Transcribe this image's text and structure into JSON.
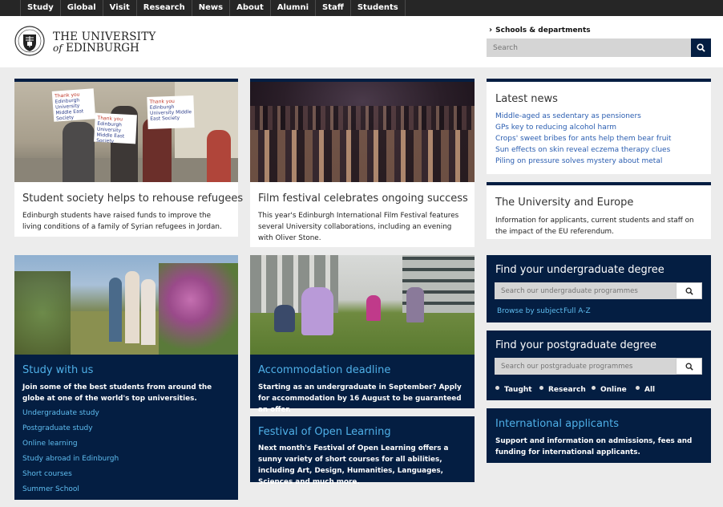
{
  "topnav": [
    "Study",
    "Global",
    "Visit",
    "Research",
    "News",
    "About",
    "Alumni",
    "Staff",
    "Students"
  ],
  "logo": {
    "line1": "THE UNIVERSITY",
    "line2_of": "of",
    "line2": "EDINBURGH"
  },
  "header": {
    "schools_link": "Schools & departments",
    "search_placeholder": "Search"
  },
  "cards": {
    "refugees": {
      "title": "Student society helps to rehouse refugees",
      "text": "Edinburgh students have raised funds to improve the living conditions of a family of Syrian refugees in Jordan.",
      "sign1": "Thank you",
      "sign2": "Edinburgh University Middle East Society"
    },
    "film": {
      "title": "Film festival celebrates ongoing success",
      "text": "This year's Edinburgh International Film Festival features several University collaborations, including an evening with Oliver Stone."
    },
    "study": {
      "title": "Study with us",
      "text": "Join some of the best students from around the globe at one of the world's top universities.",
      "links": [
        "Undergraduate study",
        "Postgraduate study",
        "Online learning",
        "Study abroad in Edinburgh",
        "Short courses",
        "Summer School"
      ]
    },
    "accommodation": {
      "title": "Accommodation deadline",
      "text": "Starting as an undergraduate in September?  Apply for accommodation by 16 August to be guaranteed an offer."
    },
    "open_learning": {
      "title": "Festival of Open Learning",
      "text": "Next month's Festival of Open Learning offers a sunny variety of short courses for all abilities, including Art, Design, Humanities, Languages, Sciences and much more."
    }
  },
  "news": {
    "title": "Latest news",
    "items": [
      "Middle-aged as sedentary as pensioners",
      "GPs key to reducing alcohol harm",
      "Crops' sweet bribes for ants help them bear fruit",
      "Sun effects on skin reveal eczema therapy clues",
      "Piling on pressure solves mystery about metal"
    ]
  },
  "europe": {
    "title": "The University and Europe",
    "text": "Information for applicants, current students and staff on the impact of the EU referendum."
  },
  "undergrad": {
    "title": "Find your undergraduate degree",
    "placeholder": "Search our undergraduate programmes",
    "links": [
      "Browse by subject",
      "Full A-Z"
    ]
  },
  "postgrad": {
    "title": "Find your postgraduate degree",
    "placeholder": "Search our postgraduate programmes",
    "options": [
      "Taught",
      "Research",
      "Online",
      "All"
    ]
  },
  "international": {
    "title": "International applicants",
    "text": "Support and information on admissions, fees and funding for international applicants."
  },
  "colors": {
    "navy": "#041e42",
    "link_blue": "#2a5db0",
    "light_blue": "#4fb0e8",
    "topbar": "#262626"
  }
}
